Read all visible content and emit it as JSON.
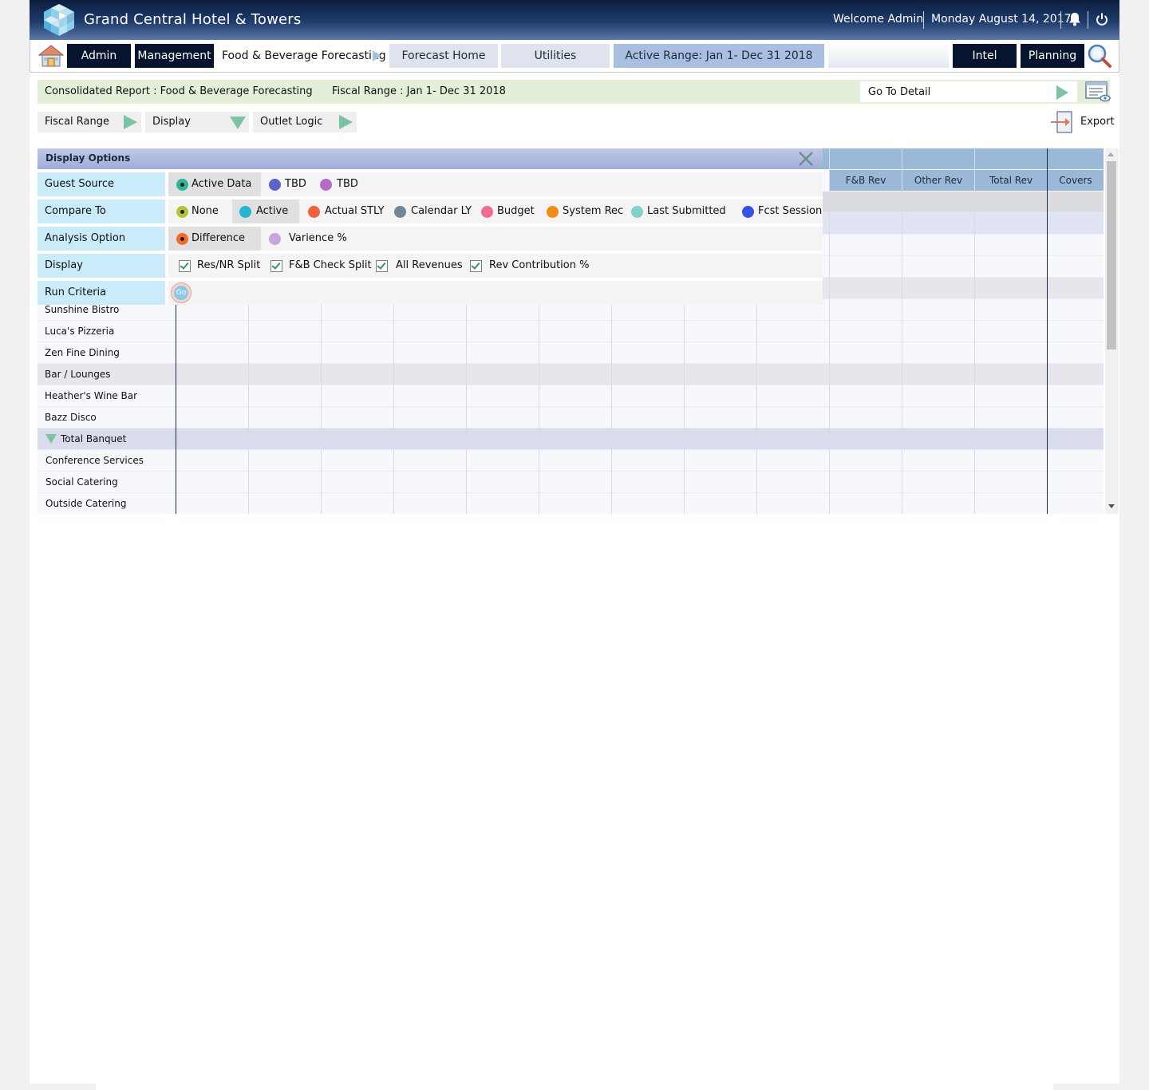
{
  "app": {
    "hotel_name": "Grand Central Hotel & Towers",
    "welcome": "Welcome Admin",
    "date": "Monday August 14, 2017"
  },
  "nav": {
    "admin": "Admin",
    "management": "Management",
    "breadcrumb": "Food & Beverage Forecasting",
    "forecast_home": "Forecast Home",
    "utilities": "Utilities",
    "active_range": "Active Range: Jan 1- Dec 31 2018",
    "blank": "",
    "intel": "Intel",
    "planning": "Planning"
  },
  "report": {
    "title": "Consolidated Report : Food & Beverage Forecasting",
    "fiscal": "Fiscal Range : Jan 1- Dec 31 2018",
    "goto_detail": "Go To Detail"
  },
  "filters": {
    "fiscal_range": "Fiscal Range",
    "display": "Display",
    "outlet_logic": "Outlet Logic",
    "export": "Export"
  },
  "grid": {
    "columns": [
      "F&B Rev",
      "Other Rev",
      "Total Rev",
      "Covers"
    ],
    "rows": [
      {
        "label": "Sunshine Bistro",
        "type": "item"
      },
      {
        "label": "Luca's Pizzeria",
        "type": "item"
      },
      {
        "label": "Zen Fine Dining",
        "type": "item"
      },
      {
        "label": "Bar / Lounges",
        "type": "group"
      },
      {
        "label": "Heather's Wine Bar",
        "type": "item"
      },
      {
        "label": "Bazz Disco",
        "type": "item"
      },
      {
        "label": "Total Banquet",
        "type": "total"
      },
      {
        "label": "Conference Services",
        "type": "item"
      },
      {
        "label": "Social Catering",
        "type": "item"
      },
      {
        "label": "Outside Catering",
        "type": "item"
      }
    ]
  },
  "panel": {
    "title": "Display Options",
    "guest_source": {
      "label": "Guest Source",
      "options": [
        {
          "text": "Active Data",
          "color": "#2bb59a",
          "selected": true
        },
        {
          "text": "TBD",
          "color": "#5b64c7",
          "selected": false
        },
        {
          "text": "TBD",
          "color": "#b66bc9",
          "selected": false
        }
      ]
    },
    "compare_to": {
      "label": "Compare To",
      "options": [
        {
          "text": "None",
          "color": "#b7c234",
          "selected": false,
          "dotted": true
        },
        {
          "text": "Active",
          "color": "#22b5d6",
          "selected": true
        },
        {
          "text": "Actual STLY",
          "color": "#f1623c",
          "selected": false
        },
        {
          "text": "Calendar LY",
          "color": "#6f8797",
          "selected": false
        },
        {
          "text": "Budget",
          "color": "#ee6d8d",
          "selected": false
        },
        {
          "text": "System Rec",
          "color": "#f28d12",
          "selected": false
        },
        {
          "text": "Last Submitted",
          "color": "#7fd1c9",
          "selected": false
        },
        {
          "text": "Fcst Session",
          "color": "#3552e8",
          "selected": false
        }
      ]
    },
    "analysis_option": {
      "label": "Analysis Option",
      "options": [
        {
          "text": "Difference",
          "color": "#f06b2c",
          "selected": true,
          "dotted": true
        },
        {
          "text": "Varience %",
          "color": "#c4a6e0",
          "selected": false
        }
      ]
    },
    "display": {
      "label": "Display",
      "options": [
        {
          "text": "Res/NR Split",
          "checked": true
        },
        {
          "text": "F&B Check Split",
          "checked": true
        },
        {
          "text": "All Revenues",
          "checked": true
        },
        {
          "text": "Rev Contribution %",
          "checked": true
        }
      ]
    },
    "run_criteria": {
      "label": "Run Criteria",
      "go": "Go"
    }
  }
}
